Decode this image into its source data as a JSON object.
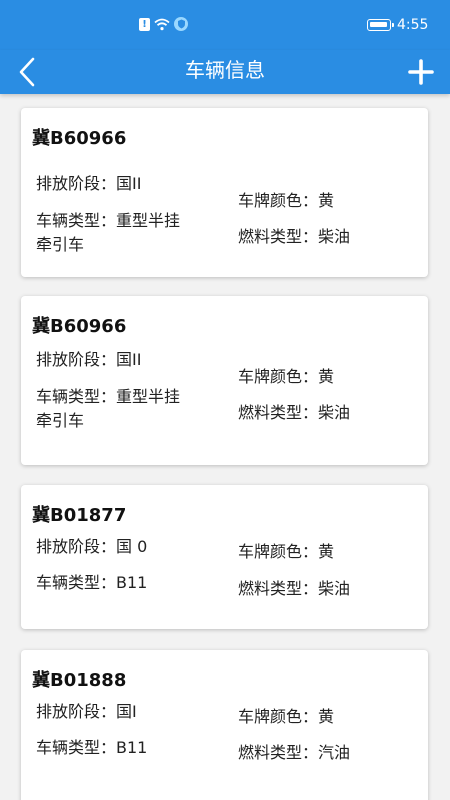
{
  "status_bar": {
    "time": "4:55",
    "icons": [
      "alert-icon",
      "wifi-icon",
      "shield-icon",
      "battery-icon"
    ]
  },
  "header": {
    "title": "车辆信息",
    "back_icon": "chevron-left-icon",
    "add_icon": "plus-icon"
  },
  "labels": {
    "emission_stage": "排放阶段：",
    "vehicle_type": "车辆类型：",
    "plate_color": "车牌颜色：",
    "fuel_type": "燃料类型："
  },
  "vehicles": [
    {
      "plate": "冀B60966",
      "emission_stage": "国II",
      "vehicle_type_line1": "重型半挂",
      "vehicle_type_line2": "牵引车",
      "plate_color": "黄",
      "fuel_type": "柴油"
    },
    {
      "plate": "冀B60966",
      "emission_stage": "国II",
      "vehicle_type_line1": "重型半挂",
      "vehicle_type_line2": "牵引车",
      "plate_color": "黄",
      "fuel_type": "柴油"
    },
    {
      "plate": "冀B01877",
      "emission_stage": "国 0",
      "vehicle_type_line1": "B11",
      "plate_color": "黄",
      "fuel_type": "柴油"
    },
    {
      "plate": "冀B01888",
      "emission_stage": "国I",
      "vehicle_type_line1": "B11",
      "plate_color": "黄",
      "fuel_type": "汽油"
    }
  ],
  "colors": {
    "primary": "#2a8de3",
    "background": "#f2f2f2",
    "card": "#ffffff"
  }
}
